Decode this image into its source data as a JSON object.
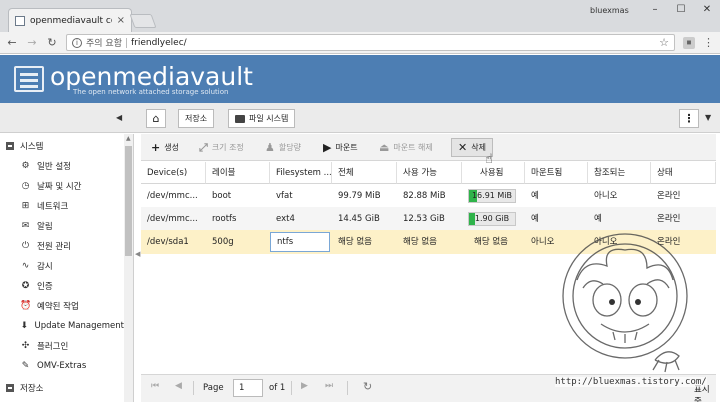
{
  "browser": {
    "tab_title": "openmediavault control",
    "tab_close": "×",
    "profile_name": "bluexmas",
    "window_controls": [
      "–",
      "☐",
      "✕"
    ],
    "security_label": "주의 요함",
    "url": "friendlyelec/"
  },
  "header": {
    "title": "openmediavault",
    "subtitle": "The open network attached storage solution"
  },
  "breadcrumb": {
    "items": [
      "저장소",
      "파일 시스템"
    ]
  },
  "sidebar": {
    "items": [
      {
        "label": "시스템",
        "type": "group",
        "icon": "minus-box"
      },
      {
        "label": "일반 설정",
        "type": "child",
        "icon": "settings-icon"
      },
      {
        "label": "날짜 및 시간",
        "type": "child",
        "icon": "clock-icon"
      },
      {
        "label": "네트워크",
        "type": "child",
        "icon": "network-icon"
      },
      {
        "label": "알림",
        "type": "child",
        "icon": "mail-icon"
      },
      {
        "label": "전원 관리",
        "type": "child",
        "icon": "power-icon"
      },
      {
        "label": "감시",
        "type": "child",
        "icon": "chart-icon"
      },
      {
        "label": "인증",
        "type": "child",
        "icon": "certificate-icon"
      },
      {
        "label": "예약된 작업",
        "type": "child",
        "icon": "alarm-icon"
      },
      {
        "label": "Update Management",
        "type": "child",
        "icon": "download-icon"
      },
      {
        "label": "플러그인",
        "type": "child",
        "icon": "puzzle-icon"
      },
      {
        "label": "OMV-Extras",
        "type": "child",
        "icon": "wrench-icon"
      },
      {
        "label": "저장소",
        "type": "group",
        "icon": "minus-box"
      }
    ]
  },
  "toolbar": {
    "create": "생성",
    "resize": "크기 조정",
    "quota": "할당량",
    "mount": "마운트",
    "unmount": "마운트 해제",
    "delete": "삭제"
  },
  "table": {
    "columns": [
      "Device(s)",
      "레이블",
      "Filesystem ...",
      "전체",
      "사용 가능",
      "사용됨",
      "마운트됨",
      "참조되는",
      "상태"
    ],
    "rows": [
      {
        "device": "/dev/mmc...",
        "label": "boot",
        "fs": "vfat",
        "total": "99.79 MiB",
        "available": "82.88 MiB",
        "used": "16.91 MiB",
        "used_fraction": 0.17,
        "mounted": "예",
        "referenced": "아니오",
        "status": "온라인"
      },
      {
        "device": "/dev/mmc...",
        "label": "rootfs",
        "fs": "ext4",
        "total": "14.45 GiB",
        "available": "12.53 GiB",
        "used": "1.90 GiB",
        "used_fraction": 0.13,
        "mounted": "예",
        "referenced": "예",
        "status": "온라인"
      },
      {
        "device": "/dev/sda1",
        "label": "500g",
        "fs": "ntfs",
        "total": "해당 없음",
        "available": "해당 없음",
        "used": "해당 없음",
        "mounted": "아니오",
        "referenced": "아니오",
        "status": "온라인"
      }
    ]
  },
  "paging": {
    "page_label": "Page",
    "page_value": "1",
    "of_label": "of 1",
    "display_suffix": "표시 중"
  },
  "watermark": {
    "url": "http://bluexmas.tistory.com/"
  }
}
